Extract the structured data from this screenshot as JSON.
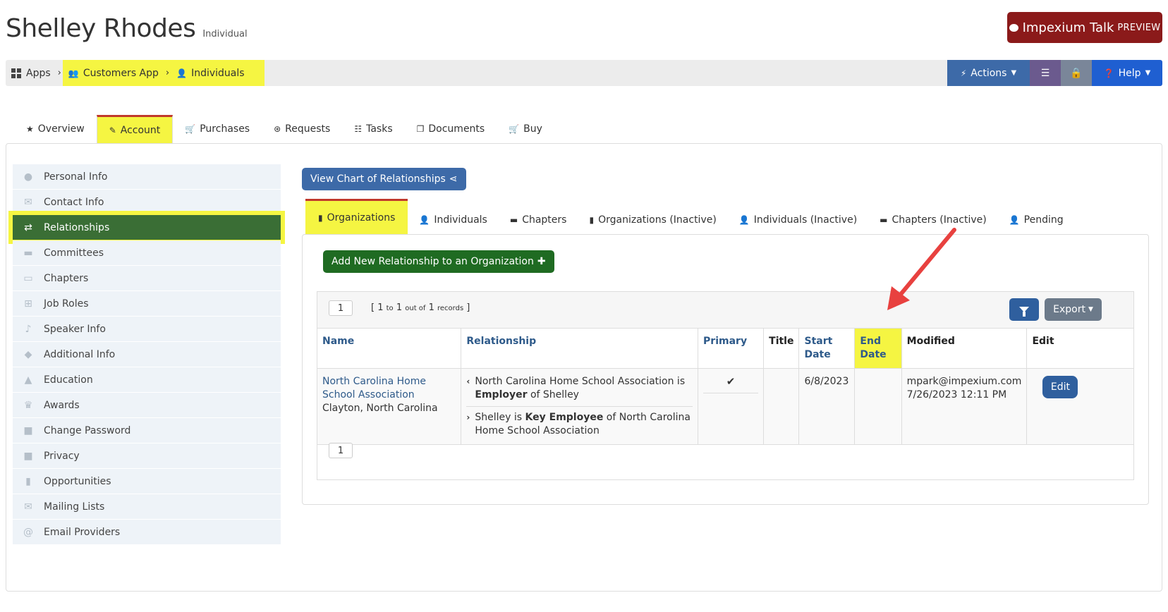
{
  "header": {
    "name": "Shelley Rhodes",
    "type": "Individual",
    "talk_label": "Impexium Talk",
    "talk_suffix": "PREVIEW"
  },
  "breadcrumbs": [
    {
      "label": "Apps",
      "icon": "grid-icon"
    },
    {
      "label": "Customers App",
      "icon": "users-icon"
    },
    {
      "label": "Individuals",
      "icon": "user-icon"
    }
  ],
  "toolbar": {
    "actions_label": "Actions",
    "help_label": "Help"
  },
  "main_tabs": [
    {
      "label": "Overview",
      "icon": "star-icon"
    },
    {
      "label": "Account",
      "icon": "edit-icon"
    },
    {
      "label": "Purchases",
      "icon": "cart-icon"
    },
    {
      "label": "Requests",
      "icon": "lifebuoy-icon"
    },
    {
      "label": "Tasks",
      "icon": "tasks-icon"
    },
    {
      "label": "Documents",
      "icon": "documents-icon"
    },
    {
      "label": "Buy",
      "icon": "cart-icon"
    }
  ],
  "sidebar": [
    {
      "label": "Personal Info",
      "icon": "user-icon"
    },
    {
      "label": "Contact Info",
      "icon": "envelope-icon"
    },
    {
      "label": "Relationships",
      "icon": "retweet-icon"
    },
    {
      "label": "Committees",
      "icon": "briefcase-icon"
    },
    {
      "label": "Chapters",
      "icon": "archive-icon"
    },
    {
      "label": "Job Roles",
      "icon": "sitemap-icon"
    },
    {
      "label": "Speaker Info",
      "icon": "microphone-icon"
    },
    {
      "label": "Additional Info",
      "icon": "tags-icon"
    },
    {
      "label": "Education",
      "icon": "graduation-cap-icon"
    },
    {
      "label": "Awards",
      "icon": "trophy-icon"
    },
    {
      "label": "Change Password",
      "icon": "lock-icon"
    },
    {
      "label": "Privacy",
      "icon": "lock-icon"
    },
    {
      "label": "Opportunities",
      "icon": "building-icon"
    },
    {
      "label": "Mailing Lists",
      "icon": "envelope-icon"
    },
    {
      "label": "Email Providers",
      "icon": "at-icon"
    }
  ],
  "chart_button": "View Chart of Relationships",
  "sub_tabs": [
    {
      "label": "Organizations",
      "icon": "building-icon"
    },
    {
      "label": "Individuals",
      "icon": "user-icon"
    },
    {
      "label": "Chapters",
      "icon": "archive-icon"
    },
    {
      "label": "Organizations (Inactive)",
      "icon": "building-icon"
    },
    {
      "label": "Individuals (Inactive)",
      "icon": "user-icon"
    },
    {
      "label": "Chapters (Inactive)",
      "icon": "archive-icon"
    },
    {
      "label": "Pending",
      "icon": "user-icon"
    }
  ],
  "add_button": "Add New Relationship to an Organization",
  "pager": {
    "page": "1",
    "range_start": "1",
    "to": "to",
    "range_end": "1",
    "out_of": "out of",
    "total": "1",
    "records": "records"
  },
  "export_label": "Export",
  "table": {
    "headers": {
      "name": "Name",
      "relationship": "Relationship",
      "primary": "Primary",
      "title": "Title",
      "start_date": "Start Date",
      "end_date": "End Date",
      "modified": "Modified",
      "edit": "Edit"
    },
    "rows": [
      {
        "org_name": "North Carolina Home School Association",
        "location": "Clayton, North Carolina",
        "rel1_pre": "North Carolina Home School Association is",
        "rel1_bold": "Employer",
        "rel1_post": "of Shelley",
        "rel2_pre": "Shelley is",
        "rel2_bold": "Key Employee",
        "rel2_post": "of North Carolina Home School Association",
        "primary": "✔",
        "title": "",
        "start_date": "6/8/2023",
        "end_date": "",
        "modified_by": "mpark@impexium.com",
        "modified_at": "7/26/2023 12:11 PM",
        "edit_label": "Edit"
      }
    ]
  },
  "colors": {
    "highlight": "#f5f542",
    "active_green": "#3a6e35",
    "primary_blue": "#3d6aa8",
    "annotation_red": "#e8413f"
  }
}
